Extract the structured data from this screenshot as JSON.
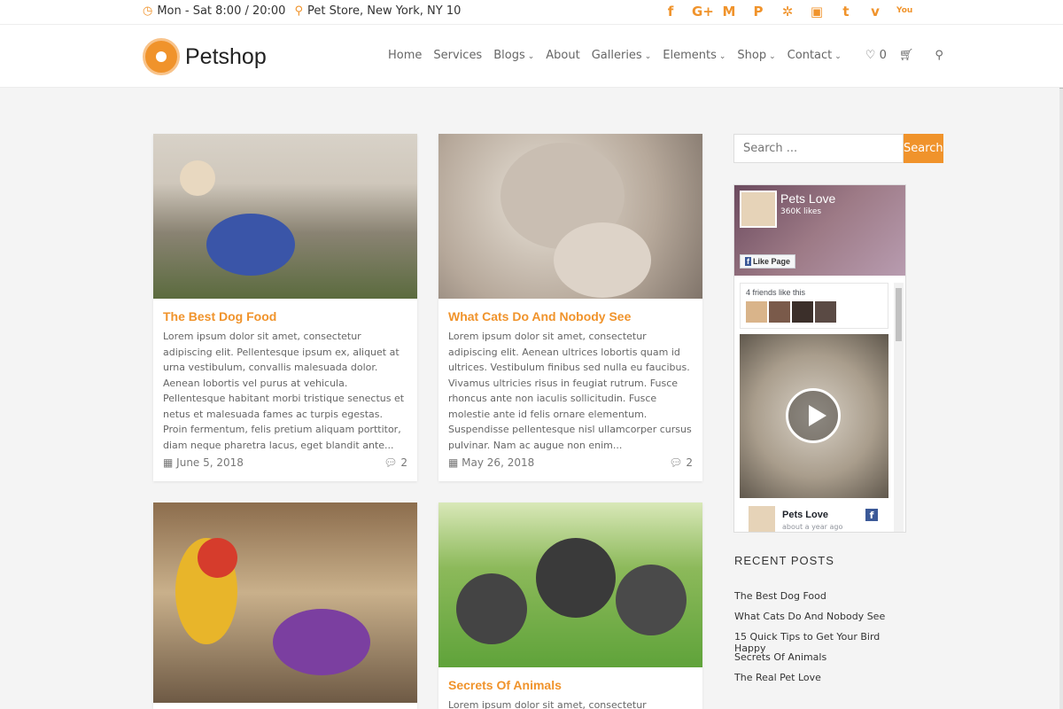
{
  "topbar": {
    "hours": "Mon - Sat 8:00 / 20:00",
    "location": "Pet Store, New York, NY 10",
    "social": [
      "f",
      "G+",
      "M",
      "P",
      "✲",
      "▣",
      "t",
      "v",
      "You"
    ]
  },
  "header": {
    "logo_text": "Petshop",
    "nav": [
      {
        "label": "Home",
        "dropdown": false
      },
      {
        "label": "Services",
        "dropdown": false
      },
      {
        "label": "Blogs",
        "dropdown": true
      },
      {
        "label": "About",
        "dropdown": false
      },
      {
        "label": "Galleries",
        "dropdown": true
      },
      {
        "label": "Elements",
        "dropdown": true
      },
      {
        "label": "Shop",
        "dropdown": true
      },
      {
        "label": "Contact",
        "dropdown": true
      }
    ],
    "wishlist_count": "0"
  },
  "posts": [
    {
      "title": "The Best Dog Food",
      "excerpt": "Lorem ipsum dolor sit amet, consectetur adipiscing elit. Pellentesque ipsum ex, aliquet at urna vestibulum, convallis malesuada dolor. Aenean lobortis vel purus at vehicula. Pellentesque habitant morbi tristique senectus et netus et malesuada fames ac turpis egestas. Proin fermentum, felis pretium aliquam porttitor, diam neque pharetra lacus, eget blandit ante...",
      "date": "June 5, 2018",
      "comments": "2"
    },
    {
      "title": "What Cats Do And Nobody See",
      "excerpt": "Lorem ipsum dolor sit amet, consectetur adipiscing elit. Aenean ultrices lobortis quam id ultrices. Vestibulum finibus sed nulla eu faucibus. Vivamus ultricies risus in feugiat rutrum. Fusce rhoncus ante non iaculis sollicitudin. Fusce molestie ante id felis ornare elementum. Suspendisse pellentesque nisl ullamcorper cursus pulvinar. Nam ac augue non enim...",
      "date": "May 26, 2018",
      "comments": "2"
    },
    {
      "title": "Secrets Of Animals",
      "excerpt": "Lorem ipsum dolor sit amet, consectetur adipiscing elit."
    }
  ],
  "sidebar": {
    "search_placeholder": "Search ...",
    "search_button": "Search",
    "fb": {
      "page_name": "Pets Love",
      "likes": "360K likes",
      "like_button": "Like Page",
      "friends_text": "4 friends like this",
      "post_name": "Pets Love",
      "post_time": "about a year ago"
    },
    "recent_title": "RECENT POSTS",
    "recent_posts": [
      "The Best Dog Food",
      "What Cats Do And Nobody See",
      "15 Quick Tips to Get Your Bird Happy",
      "Secrets Of Animals",
      "The Real Pet Love"
    ]
  },
  "colors": {
    "accent": "#f0932b",
    "facebook": "#3b5998"
  }
}
